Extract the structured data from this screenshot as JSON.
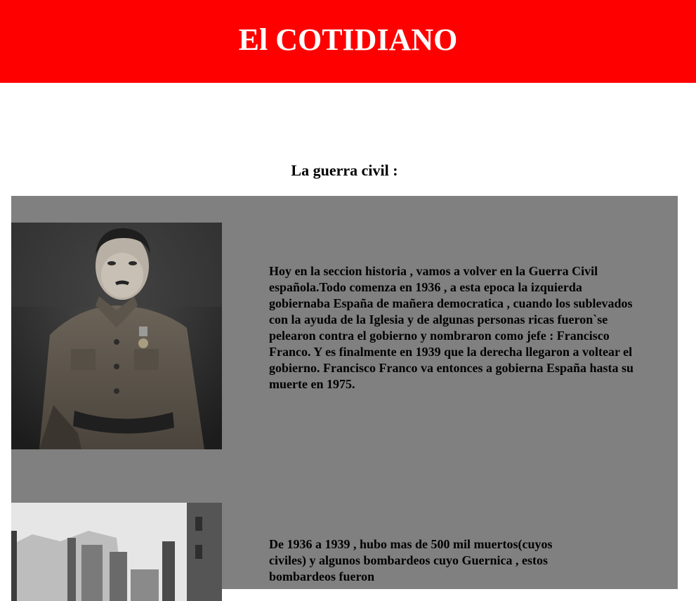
{
  "header": {
    "title": "El COTIDIANO",
    "background_color": "#ff0000"
  },
  "section": {
    "title": "La guerra civil :"
  },
  "articles": [
    {
      "image_icon": "portrait-photo-icon",
      "text": "Hoy en la seccion historia , vamos a volver en la Guerra Civil española.Todo comenza en 1936 , a esta epoca la izquierda gobiernaba España de mañera democratica , cuando los sublevados con la ayuda de la Iglesia y de algunas personas ricas fueron`se pelearon contra el gobierno y nombraron como jefe : Francisco Franco. Y es finalmente en 1939 que la derecha llegaron a voltear el gobierno. Francisco Franco va entonces a gobierna España hasta su muerte en 1975."
    },
    {
      "image_icon": "ruins-photo-icon",
      "text": "De 1936 a 1939 , hubo mas de 500 mil muertos(cuyos civiles) y algunos bombardeos cuyo Guernica , estos bombardeos fueron"
    }
  ],
  "panel_color": "#808080"
}
